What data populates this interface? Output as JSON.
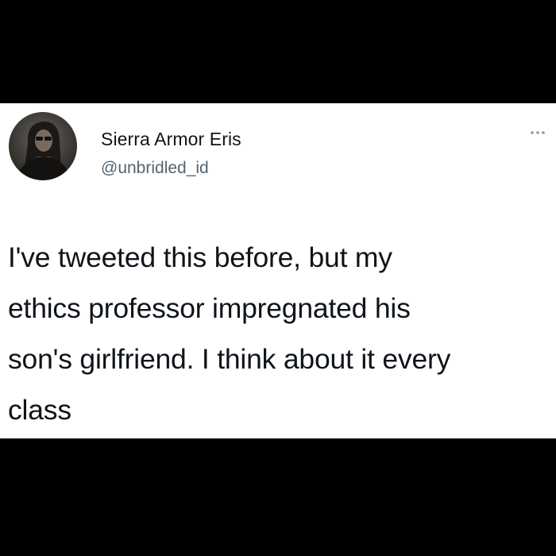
{
  "tweet": {
    "display_name": "Sierra Armor Eris",
    "handle": "@unbridled_id",
    "text": "I've tweeted this before, but my\nethics professor impregnated his\nson's girlfriend. I think about it every\nclass",
    "avatar_icon": "profile-photo-icon",
    "menu_icon": "more-dots-icon"
  },
  "colors": {
    "background": "#000000",
    "card": "#ffffff",
    "primary_text": "#0f1419",
    "secondary_text": "#536471"
  }
}
